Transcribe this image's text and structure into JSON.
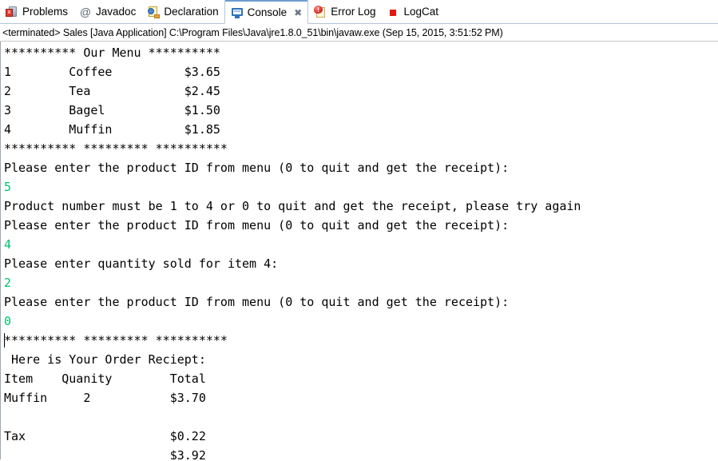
{
  "viewbar": {
    "tabs": [
      {
        "label": "Problems",
        "icon": "problems-icon",
        "active": false,
        "closable": false
      },
      {
        "label": "Javadoc",
        "icon": "at-icon",
        "active": false,
        "closable": false
      },
      {
        "label": "Declaration",
        "icon": "declaration-icon",
        "active": false,
        "closable": false
      },
      {
        "label": "Console",
        "icon": "console-icon",
        "active": true,
        "closable": true
      },
      {
        "label": "Error Log",
        "icon": "error-log-icon",
        "active": false,
        "closable": false
      },
      {
        "label": "LogCat",
        "icon": "logcat-icon",
        "active": false,
        "closable": false
      }
    ],
    "close_glyph": "✖"
  },
  "launch": {
    "text": "<terminated> Sales [Java Application] C:\\Program Files\\Java\\jre1.8.0_51\\bin\\javaw.exe (Sep 15, 2015, 3:51:52 PM)"
  },
  "colors": {
    "stdout": "#000000",
    "stdin": "#00c26e",
    "tab_active_top": "#6d9cd1",
    "logcat_marker": "#e11b14"
  },
  "console": {
    "lines": [
      {
        "text": "********** Our Menu **********",
        "stream": "out",
        "caret": false
      },
      {
        "text": "1        Coffee          $3.65",
        "stream": "out",
        "caret": false
      },
      {
        "text": "2        Tea             $2.45",
        "stream": "out",
        "caret": false
      },
      {
        "text": "3        Bagel           $1.50",
        "stream": "out",
        "caret": false
      },
      {
        "text": "4        Muffin          $1.85",
        "stream": "out",
        "caret": false
      },
      {
        "text": "********** ********* **********",
        "stream": "out",
        "caret": false
      },
      {
        "text": "Please enter the product ID from menu (0 to quit and get the receipt):",
        "stream": "out",
        "caret": false
      },
      {
        "text": "5",
        "stream": "in",
        "caret": false
      },
      {
        "text": "Product number must be 1 to 4 or 0 to quit and get the receipt, please try again",
        "stream": "out",
        "caret": false
      },
      {
        "text": "Please enter the product ID from menu (0 to quit and get the receipt):",
        "stream": "out",
        "caret": false
      },
      {
        "text": "4",
        "stream": "in",
        "caret": false
      },
      {
        "text": "Please enter quantity sold for item 4:",
        "stream": "out",
        "caret": false
      },
      {
        "text": "2",
        "stream": "in",
        "caret": false
      },
      {
        "text": "Please enter the product ID from menu (0 to quit and get the receipt):",
        "stream": "out",
        "caret": false
      },
      {
        "text": "0",
        "stream": "in",
        "caret": false
      },
      {
        "text": "********** ********* **********",
        "stream": "out",
        "caret": true
      },
      {
        "text": " Here is Your Order Reciept:",
        "stream": "out",
        "caret": false
      },
      {
        "text": "Item    Quanity        Total",
        "stream": "out",
        "caret": false
      },
      {
        "text": "Muffin     2           $3.70",
        "stream": "out",
        "caret": false
      },
      {
        "text": "",
        "stream": "out",
        "caret": false
      },
      {
        "text": "Tax                    $0.22",
        "stream": "out",
        "caret": false
      },
      {
        "text": "                       $3.92",
        "stream": "out",
        "caret": false
      }
    ],
    "menu_items": [
      {
        "id": "1",
        "name": "Coffee",
        "price": "$3.65"
      },
      {
        "id": "2",
        "name": "Tea",
        "price": "$2.45"
      },
      {
        "id": "3",
        "name": "Bagel",
        "price": "$1.50"
      },
      {
        "id": "4",
        "name": "Muffin",
        "price": "$1.85"
      }
    ],
    "receipt": {
      "title": " Here is Your Order Reciept:",
      "headers": [
        "Item",
        "Quanity",
        "Total"
      ],
      "rows": [
        [
          "Muffin",
          "2",
          "$3.70"
        ]
      ],
      "tax_label": "Tax",
      "tax_value": "$0.22",
      "total_value": "$3.92"
    }
  }
}
